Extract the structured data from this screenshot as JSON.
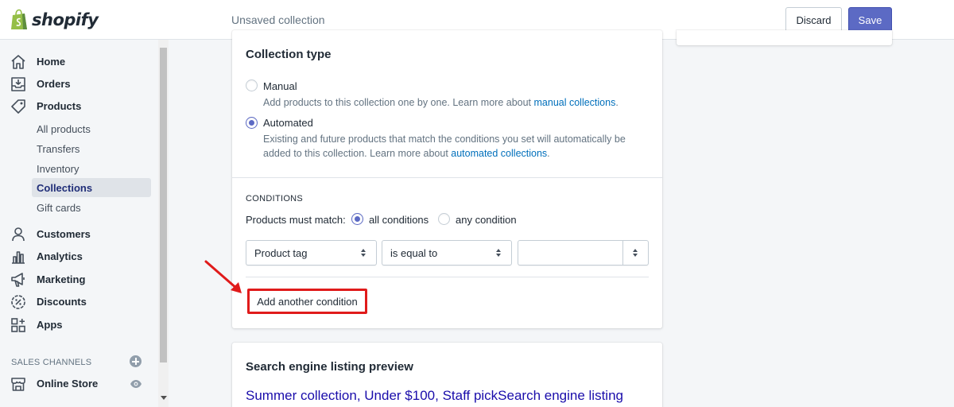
{
  "brand": {
    "name": "shopify"
  },
  "header": {
    "title": "Unsaved collection",
    "discard_label": "Discard",
    "save_label": "Save",
    "accent": "#5c6ac4"
  },
  "sidebar": {
    "items": [
      {
        "label": "Home",
        "icon": "home-icon"
      },
      {
        "label": "Orders",
        "icon": "orders-icon"
      },
      {
        "label": "Products",
        "icon": "tag-icon"
      },
      {
        "label": "Customers",
        "icon": "person-icon"
      },
      {
        "label": "Analytics",
        "icon": "bar-chart-icon"
      },
      {
        "label": "Marketing",
        "icon": "megaphone-icon"
      },
      {
        "label": "Discounts",
        "icon": "discount-icon"
      },
      {
        "label": "Apps",
        "icon": "apps-icon"
      }
    ],
    "product_subitems": [
      "All products",
      "Transfers",
      "Inventory",
      "Collections",
      "Gift cards"
    ],
    "active_subitem": "Collections",
    "channels_header": "SALES CHANNELS",
    "channels": [
      {
        "label": "Online Store",
        "icon": "store-icon"
      }
    ]
  },
  "collection_type": {
    "heading": "Collection type",
    "manual": {
      "label": "Manual",
      "help": "Add products to this collection one by one. Learn more about ",
      "link": "manual collections",
      "suffix": "."
    },
    "automated": {
      "label": "Automated",
      "help_line1": "Existing and future products that match the conditions you set will automatically be",
      "help_line2": "added to this collection. Learn more about ",
      "link": "automated collections",
      "suffix": "."
    },
    "selected": "Automated"
  },
  "conditions": {
    "heading": "CONDITIONS",
    "match_label": "Products must match:",
    "all_label": "all conditions",
    "any_label": "any condition",
    "selected": "all conditions",
    "rule": {
      "field": "Product tag",
      "operator": "is equal to",
      "value": ""
    },
    "add_label": "Add another condition"
  },
  "seo": {
    "heading": "Search engine listing preview",
    "title": "Summer collection, Under $100, Staff pickSearch engine listing"
  },
  "annotation": {
    "highlight_color": "#e01b1b"
  }
}
